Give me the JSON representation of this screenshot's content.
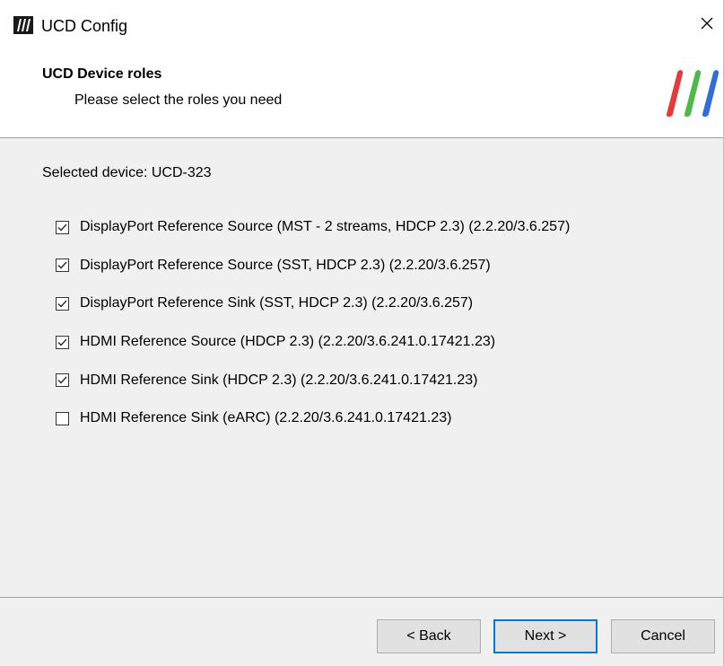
{
  "window": {
    "title": "UCD Config",
    "close_glyph": "✕"
  },
  "header": {
    "title": "UCD Device roles",
    "subtitle": "Please select the roles you need"
  },
  "content": {
    "selected_device": "Selected device: UCD-323",
    "roles": [
      {
        "label": "DisplayPort Reference Source (MST - 2 streams, HDCP 2.3) (2.2.20/3.6.257)",
        "checked": true
      },
      {
        "label": "DisplayPort Reference Source (SST, HDCP 2.3) (2.2.20/3.6.257)",
        "checked": true
      },
      {
        "label": "DisplayPort Reference Sink (SST, HDCP 2.3) (2.2.20/3.6.257)",
        "checked": true
      },
      {
        "label": "HDMI Reference Source (HDCP 2.3) (2.2.20/3.6.241.0.17421.23)",
        "checked": true
      },
      {
        "label": "HDMI Reference Sink (HDCP 2.3) (2.2.20/3.6.241.0.17421.23)",
        "checked": true
      },
      {
        "label": "HDMI Reference Sink (eARC) (2.2.20/3.6.241.0.17421.23)",
        "checked": false
      }
    ]
  },
  "footer": {
    "back_label": "< Back",
    "next_label": "Next >",
    "cancel_label": "Cancel"
  },
  "colors": {
    "logo_red": "#e63a3a",
    "logo_green": "#4fb848",
    "logo_blue": "#2f6fd6",
    "default_button_border": "#0078d7"
  },
  "icons": {
    "app": "app-logo-icon",
    "close": "close-icon",
    "brand": "brand-logo-icon",
    "checkbox": "checkmark-icon"
  }
}
